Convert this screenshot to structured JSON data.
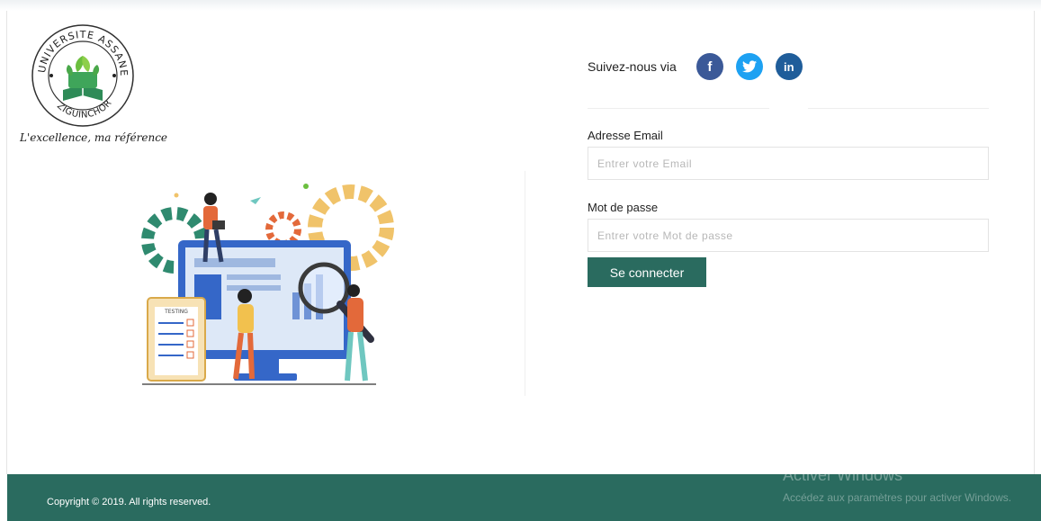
{
  "logo": {
    "arc_text": "UNIVERSITE ASSANE SECK",
    "city_text": "ZIGUINCHOR",
    "motto": "L'excellence, ma référence"
  },
  "illustration": {
    "board_label": "TESTING"
  },
  "social": {
    "label": "Suivez-nous via",
    "facebook_glyph": "f",
    "linkedin_glyph": "in"
  },
  "form": {
    "email_label": "Adresse Email",
    "email_placeholder": "Entrer votre Email",
    "email_value": "",
    "password_label": "Mot de passe",
    "password_placeholder": "Entrer votre Mot de passe",
    "password_value": "",
    "submit_label": "Se connecter"
  },
  "footer": {
    "copyright": "Copyright © 2019. All rights reserved.",
    "activation_title": "Activer Windows",
    "activation_subtitle": "Accédez aux paramètres pour activer Windows."
  },
  "colors": {
    "primary": "#2a6b5f",
    "facebook": "#3b5998",
    "twitter": "#1da1f2",
    "linkedin": "#1f5d9a"
  }
}
